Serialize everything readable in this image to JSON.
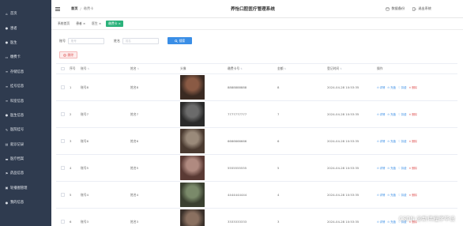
{
  "sidebar": {
    "items": [
      {
        "label": "首页",
        "icon": "home-icon"
      },
      {
        "label": "患者",
        "icon": "user-icon"
      },
      {
        "label": "医生",
        "icon": "user-icon"
      },
      {
        "label": "缴费卡",
        "icon": "card-icon"
      },
      {
        "label": "存储信息",
        "icon": "list-icon"
      },
      {
        "label": "挂号信息",
        "icon": "list-icon"
      },
      {
        "label": "科室信息",
        "icon": "list-icon"
      },
      {
        "label": "医生信息",
        "icon": "user-icon"
      },
      {
        "label": "医院挂号",
        "icon": "edit-icon"
      },
      {
        "label": "就诊记录",
        "icon": "document-icon"
      },
      {
        "label": "医疗档案",
        "icon": "folder-icon"
      },
      {
        "label": "药品信息",
        "icon": "flag-icon"
      },
      {
        "label": "轮播图管理",
        "icon": "image-icon"
      },
      {
        "label": "我的信息",
        "icon": "user-icon"
      }
    ]
  },
  "topbar": {
    "breadcrumb_home": "首页",
    "breadcrumb_sep": "/",
    "breadcrumb_current": "缴费卡",
    "system_title": "养怡口腔医疗管理系统",
    "backup_label": "数据备份",
    "logout_label": "退出系统"
  },
  "tabs": [
    {
      "label": "系统首页",
      "active": false
    },
    {
      "label": "患者 ×",
      "active": false
    },
    {
      "label": "医生 ×",
      "active": false
    },
    {
      "label": "缴费卡 ×",
      "active": true
    }
  ],
  "search": {
    "account_label": "账号",
    "account_placeholder": "账号",
    "name_label": "姓名",
    "name_placeholder": "姓名",
    "search_button": "搜索"
  },
  "delete_button": "删除",
  "table": {
    "headers": {
      "index": "序号",
      "account": "账号",
      "name": "姓名",
      "avatar": "头像",
      "card_no": "缴费卡号",
      "amount": "金额",
      "time": "登记时间",
      "ops": "操作"
    },
    "actions": [
      "详情",
      "充值",
      "扣费",
      "删除"
    ],
    "rows": [
      {
        "index": "1",
        "account": "账号8",
        "name": "姓名8",
        "card_no": "8888888888",
        "amount": "8",
        "time": "2024-04-28 10:53:35"
      },
      {
        "index": "2",
        "account": "账号7",
        "name": "姓名7",
        "card_no": "7777777777",
        "amount": "7",
        "time": "2024-04-28 10:53:35"
      },
      {
        "index": "3",
        "account": "账号6",
        "name": "姓名6",
        "card_no": "6666666666",
        "amount": "6",
        "time": "2024-04-28 10:53:35"
      },
      {
        "index": "4",
        "account": "账号5",
        "name": "姓名5",
        "card_no": "5555555555",
        "amount": "5",
        "time": "2024-04-28 10:53:35"
      },
      {
        "index": "5",
        "account": "账号4",
        "name": "姓名4",
        "card_no": "4444444444",
        "amount": "4",
        "time": "2024-04-28 10:53:35"
      },
      {
        "index": "6",
        "account": "账号3",
        "name": "姓名3",
        "card_no": "3333333333",
        "amount": "3",
        "time": "2024-04-28 10:53:35"
      }
    ]
  },
  "watermark": "CSDN @新伟程序毕设",
  "colors": {
    "sidebar_bg": "#2f3b4f",
    "primary": "#3a8ee6",
    "active_tab": "#2bb27b",
    "danger": "#e05a5a"
  }
}
